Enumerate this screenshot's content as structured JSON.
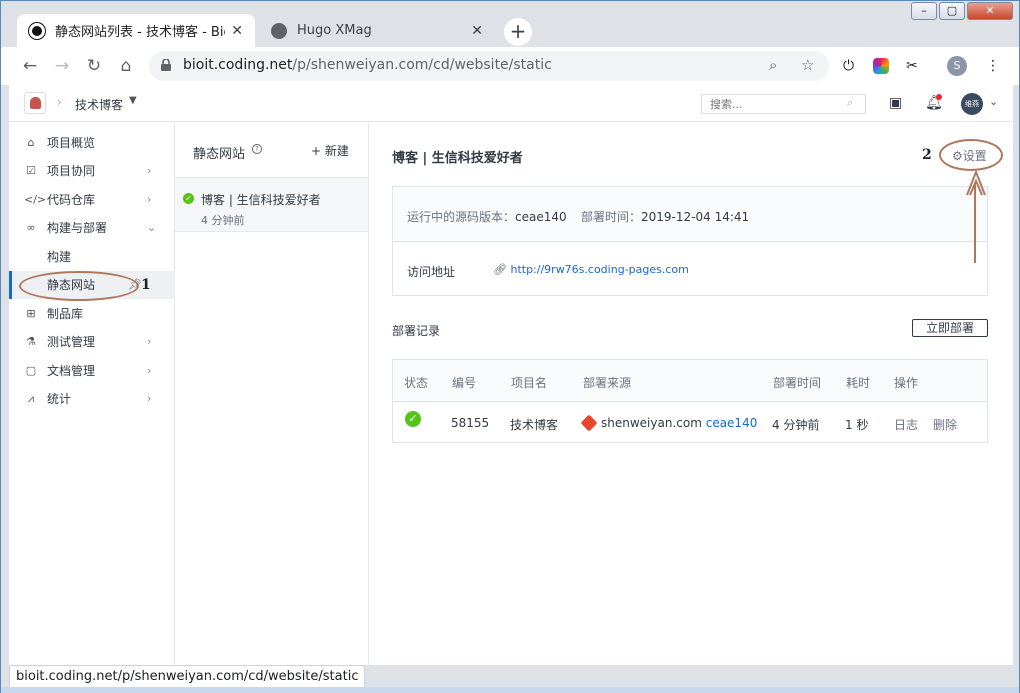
{
  "browser": {
    "tabs": [
      {
        "title": "静态网站列表 - 技术博客 - Bio IT",
        "close": "✕"
      },
      {
        "title": "Hugo XMag",
        "close": "✕"
      }
    ],
    "new_tab": "+",
    "window_buttons": {
      "minimize": "–",
      "maximize": "▢",
      "close": "✕"
    },
    "url_host": "bioit.coding.net",
    "url_path": "/p/shenweiyan.com/cd/website/static",
    "profile_initial": "S"
  },
  "topbar": {
    "breadcrumb": "技术博客",
    "search_placeholder": "搜索...",
    "avatar_text": "维燕"
  },
  "sidebar": {
    "items": [
      {
        "icon": "⌂",
        "label": "项目概览",
        "arrow": ""
      },
      {
        "icon": "☑",
        "label": "项目协同",
        "arrow": "›"
      },
      {
        "icon": "</>",
        "label": "代码仓库",
        "arrow": "›"
      },
      {
        "icon": "∞",
        "label": "构建与部署",
        "arrow": "⌄"
      },
      {
        "icon": "",
        "label": "构建",
        "arrow": ""
      },
      {
        "icon": "",
        "label": "静态网站",
        "arrow": ""
      },
      {
        "icon": "⊞",
        "label": "制品库",
        "arrow": ""
      },
      {
        "icon": "⚗",
        "label": "测试管理",
        "arrow": "›"
      },
      {
        "icon": "▢",
        "label": "文档管理",
        "arrow": "›"
      },
      {
        "icon": "⩘",
        "label": "统计",
        "arrow": "›"
      }
    ]
  },
  "sites_panel": {
    "title": "静态网站",
    "new_label": "+ 新建",
    "items": [
      {
        "name": "博客 | 生信科技爱好者",
        "time": "4 分钟前"
      }
    ]
  },
  "main": {
    "title": "博客 | 生信科技爱好者",
    "settings_label": "设置",
    "source_version_label": "运行中的源码版本：",
    "source_version": "ceae140",
    "deploy_time_label": "部署时间：",
    "deploy_time": "2019-12-04 14:41",
    "visit_label": "访问地址",
    "visit_url": "http://9rw76s.coding-pages.com",
    "records_title": "部署记录",
    "deploy_now": "立即部署",
    "table": {
      "headers": [
        "状态",
        "编号",
        "项目名",
        "部署来源",
        "部署时间",
        "耗时",
        "操作"
      ],
      "rows": [
        {
          "id": "58155",
          "project": "技术博客",
          "source_repo": "shenweiyan.com",
          "source_commit": "ceae140",
          "time": "4 分钟前",
          "duration": "1 秒",
          "action_log": "日志",
          "action_delete": "删除"
        }
      ]
    }
  },
  "annotations": {
    "one": "1",
    "two": "2"
  },
  "status_bar": "bioit.coding.net/p/shenweiyan.com/cd/website/static",
  "colors": {
    "accent": "#1569d6",
    "success": "#52c41a",
    "annotation": "#b0785a"
  }
}
